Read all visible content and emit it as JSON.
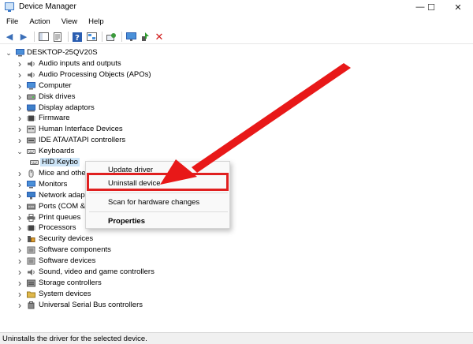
{
  "window": {
    "title": "Device Manager",
    "minimize_glyph": "—",
    "maximize_glyph": "☐",
    "close_glyph": "✕"
  },
  "menu": [
    "File",
    "Action",
    "View",
    "Help"
  ],
  "tree": {
    "root": "DESKTOP-25QV20S",
    "categories": [
      {
        "label": "Audio inputs and outputs",
        "icon": "speaker-icon",
        "expanded": false
      },
      {
        "label": "Audio Processing Objects (APOs)",
        "icon": "speaker-icon",
        "expanded": false
      },
      {
        "label": "Computer",
        "icon": "monitor-icon",
        "expanded": false
      },
      {
        "label": "Disk drives",
        "icon": "disk-icon",
        "expanded": false
      },
      {
        "label": "Display adaptors",
        "icon": "display-adapter-icon",
        "expanded": false
      },
      {
        "label": "Firmware",
        "icon": "chip-icon",
        "expanded": false
      },
      {
        "label": "Human Interface Devices",
        "icon": "hid-icon",
        "expanded": false
      },
      {
        "label": "IDE ATA/ATAPI controllers",
        "icon": "controller-icon",
        "expanded": false
      },
      {
        "label": "Keyboards",
        "icon": "keyboard-icon",
        "expanded": true
      },
      {
        "label": "HID Keybo",
        "icon": "keyboard-icon",
        "child": true
      },
      {
        "label": "Mice and othe",
        "icon": "mouse-icon",
        "expanded": false
      },
      {
        "label": "Monitors",
        "icon": "monitor-icon",
        "expanded": false
      },
      {
        "label": "Network adap",
        "icon": "network-icon",
        "expanded": false
      },
      {
        "label": "Ports (COM &",
        "icon": "port-icon",
        "expanded": false
      },
      {
        "label": "Print queues",
        "icon": "printer-icon",
        "expanded": false
      },
      {
        "label": "Processors",
        "icon": "chip-icon",
        "expanded": false
      },
      {
        "label": "Security devices",
        "icon": "security-icon",
        "expanded": false
      },
      {
        "label": "Software components",
        "icon": "software-icon",
        "expanded": false
      },
      {
        "label": "Software devices",
        "icon": "software-icon",
        "expanded": false
      },
      {
        "label": "Sound, video and game controllers",
        "icon": "speaker-icon",
        "expanded": false
      },
      {
        "label": "Storage controllers",
        "icon": "storage-icon",
        "expanded": false
      },
      {
        "label": "System devices",
        "icon": "folder-icon",
        "expanded": false
      },
      {
        "label": "Universal Serial Bus controllers",
        "icon": "usb-icon",
        "expanded": false
      }
    ]
  },
  "context_menu": {
    "items": [
      "Update driver",
      "Uninstall device",
      "Scan for hardware changes",
      "Properties"
    ]
  },
  "status": "Uninstalls the driver for the selected device.",
  "colors": {
    "highlight": "#e02020",
    "arrow": "#e81818"
  }
}
